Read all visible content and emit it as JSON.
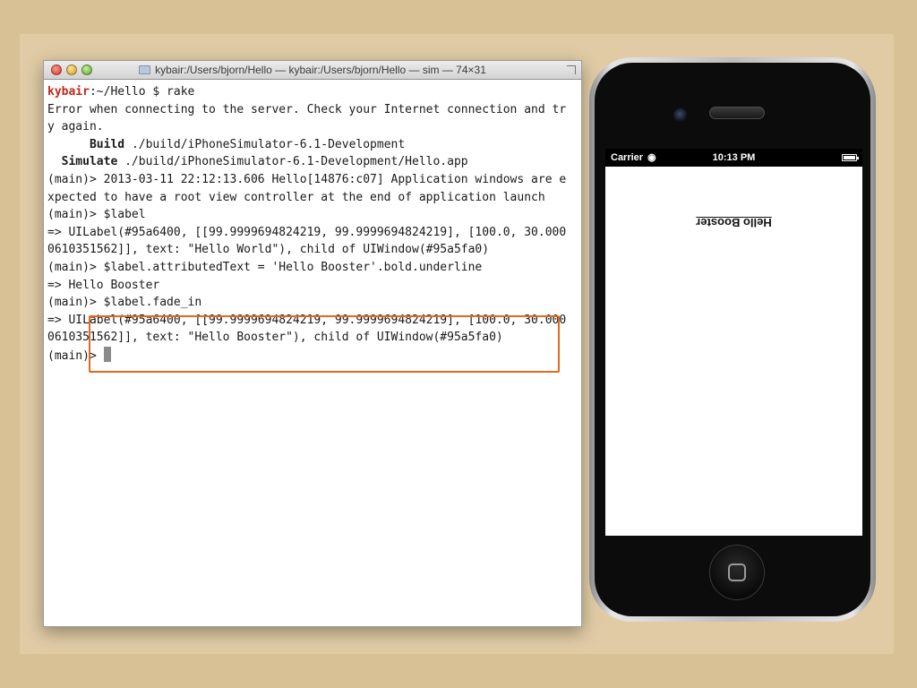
{
  "terminal": {
    "title": "kybair:/Users/bjorn/Hello — kybair:/Users/bjorn/Hello — sim — 74×31",
    "prompt_user": "kybair",
    "prompt_rest": ":~/Hello $ rake",
    "lines": [
      "Error when connecting to the server. Check your Internet connection and tr",
      "y again."
    ],
    "build_label": "Build",
    "build_path": "./build/iPhoneSimulator-6.1-Development",
    "simulate_label": "Simulate",
    "simulate_path": "./build/iPhoneSimulator-6.1-Development/Hello.app",
    "lines2": [
      "(main)> 2013-03-11 22:12:13.606 Hello[14876:c07] Application windows are e",
      "xpected to have a root view controller at the end of application launch",
      "(main)> $label",
      "=> UILabel(#95a6400, [[99.9999694824219, 99.9999694824219], [100.0, 30.000",
      "0610351562]], text: \"Hello World\"), child of UIWindow(#95a5fa0)",
      "(main)> $label.attributedText = 'Hello Booster'.bold.underline",
      "=> Hello Booster",
      "(main)> $label.fade_in",
      "=> UILabel(#95a6400, [[99.9999694824219, 99.9999694824219], [100.0, 30.000",
      "0610351562]], text: \"Hello Booster\"), child of UIWindow(#95a5fa0)"
    ],
    "last_prompt": "(main)> "
  },
  "iphone": {
    "carrier": "Carrier",
    "time": "10:13 PM",
    "label_text": "Hello Booster"
  },
  "colors": {
    "background": "#d9c196",
    "highlight": "#e06a1f",
    "prompt_user": "#c0281b"
  }
}
